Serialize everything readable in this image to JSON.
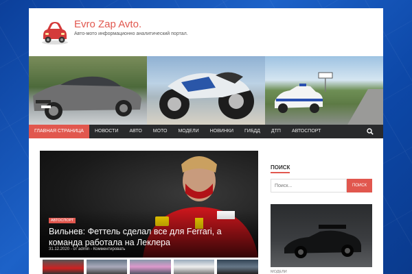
{
  "site": {
    "title": "Evro Zap Avto.",
    "description": "Авто-мото информационно аналитический портал."
  },
  "nav": {
    "items": [
      {
        "label": "ГЛАВНАЯ СТРАНИЦА",
        "active": true
      },
      {
        "label": "НОВОСТИ"
      },
      {
        "label": "АВТО"
      },
      {
        "label": "МОТО"
      },
      {
        "label": "МОДЕЛИ"
      },
      {
        "label": "НОВИНКИ"
      },
      {
        "label": "ГИБДД"
      },
      {
        "label": "ДТП"
      },
      {
        "label": "АВТОСПОРТ"
      }
    ],
    "search_icon": "search-icon"
  },
  "featured": {
    "category": "АВТОСПОРТ",
    "title": "Вильнев: Феттель сделал все для Ferrari, а команда работала на Леклера",
    "date": "31.12.2020",
    "author_prefix": "от",
    "author": "admin",
    "comments": "Комментировать"
  },
  "sidebar": {
    "search_title": "ПОИСК",
    "search_placeholder": "Поиск...",
    "search_button": "ПОИСК",
    "caption": "МОДЕЛИ"
  },
  "colors": {
    "accent": "#e1574e",
    "nav_bg": "#292a2c"
  }
}
